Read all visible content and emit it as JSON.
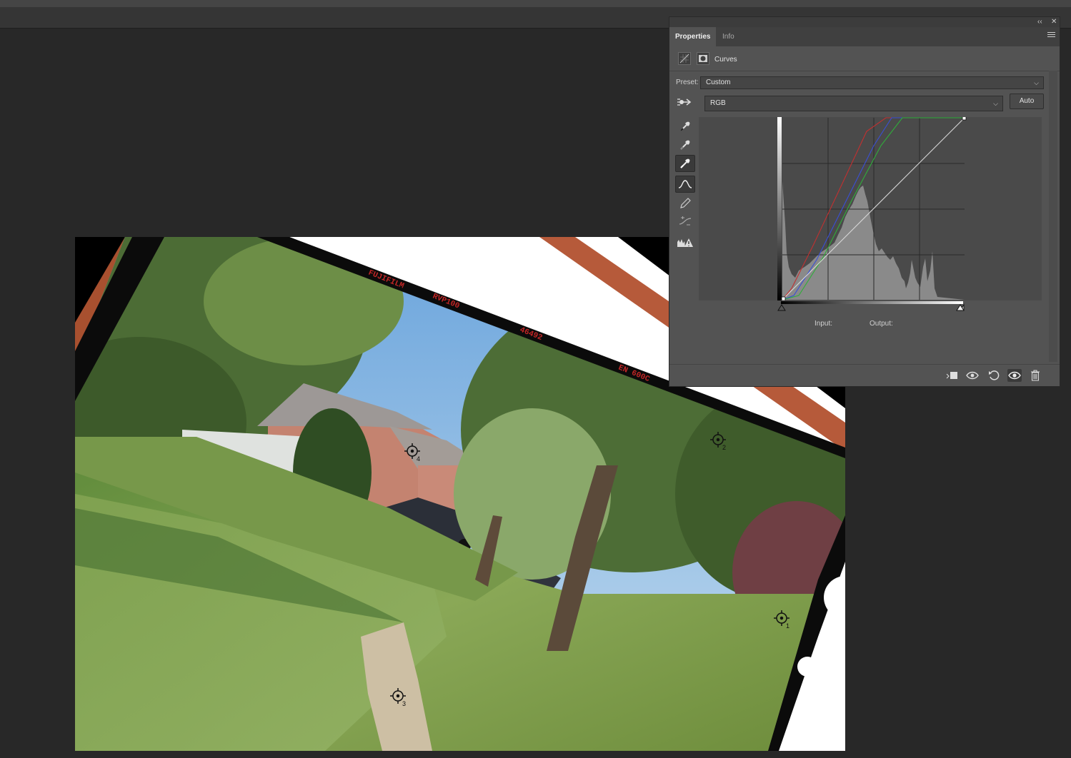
{
  "panel": {
    "collapse_glyph": "‹‹",
    "close_glyph": "✕",
    "tabs": [
      {
        "label": "Properties",
        "active": true
      },
      {
        "label": "Info",
        "active": false
      }
    ],
    "menu_icon": "panel-menu-icon"
  },
  "curves": {
    "title": "Curves",
    "preset_label": "Preset:",
    "preset_value": "Custom",
    "channel_value": "RGB",
    "auto_label": "Auto",
    "input_label": "Input:",
    "output_label": "Output:",
    "curve_colors": {
      "red": "#c23030",
      "green": "#2fae3a",
      "blue": "#3a4fd6",
      "rgb": "#d9d9d9"
    },
    "tools": [
      "on-image-adjust-icon",
      "black-point-eyedropper-icon",
      "gray-point-eyedropper-icon",
      "white-point-eyedropper-icon",
      "curve-edit-points-icon",
      "pencil-draw-icon",
      "smooth-curve-icon",
      "clipping-warning-icon"
    ]
  },
  "footer": {
    "buttons": [
      "clip-to-layer-icon",
      "view-previous-state-icon",
      "reset-icon",
      "visibility-eye-icon",
      "delete-trash-icon"
    ]
  },
  "image": {
    "film_edge_text_1": "FUJIFILM",
    "film_edge_text_2": "RVP100",
    "film_edge_text_3": "46492",
    "film_edge_text_4": "EN 600C",
    "color_samplers": [
      {
        "label": "1"
      },
      {
        "label": "2"
      },
      {
        "label": "3"
      },
      {
        "label": "4"
      }
    ]
  }
}
